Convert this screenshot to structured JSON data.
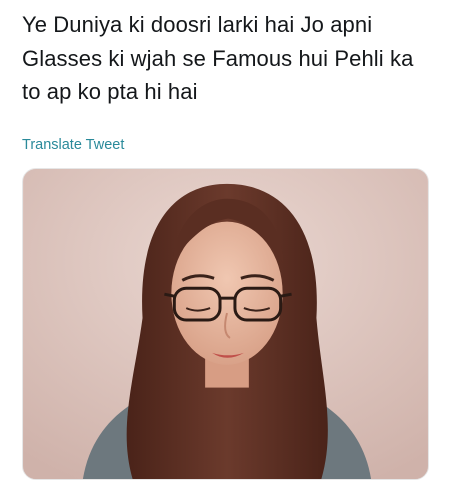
{
  "tweet": {
    "text_lines": [
      "Ye Duniya ki doosri larki hai Jo apni",
      "Glasses ki wjah se Famous hui Pehli ka",
      "to ap ko pta hi hai"
    ],
    "translate_label": "Translate Tweet"
  },
  "media": {
    "kind": "photo",
    "colors": {
      "background": "#dcc3bd",
      "hair": "#5a2f24",
      "skin": "#e2b29a",
      "shirt": "#6f7a80",
      "glasses": "#2a1a14",
      "lips": "#c0504a"
    }
  }
}
